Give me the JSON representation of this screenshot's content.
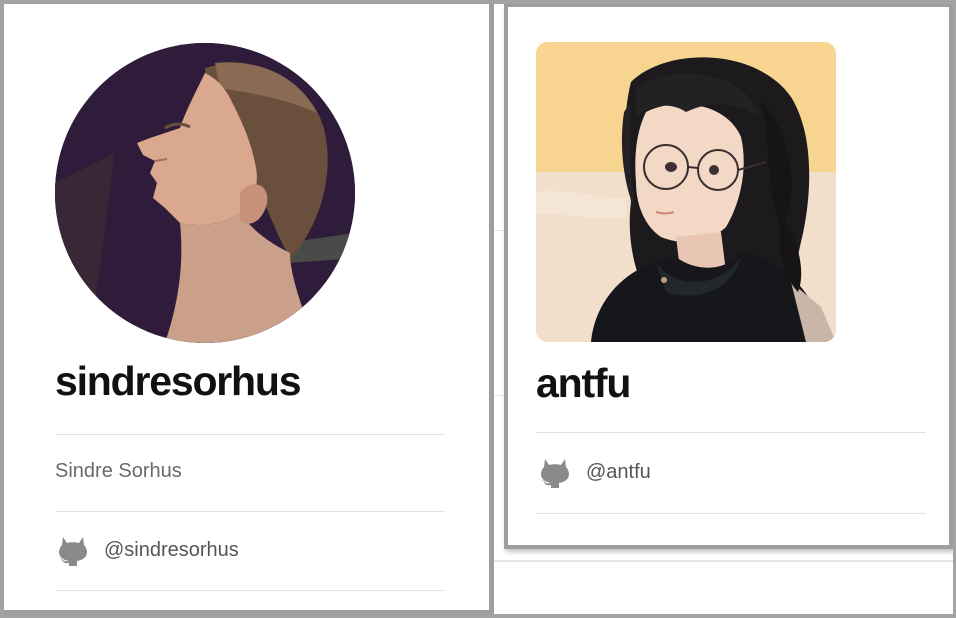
{
  "cards": [
    {
      "username": "sindresorhus",
      "full_name": "Sindre Sorhus",
      "github_handle": "@sindresorhus",
      "avatar_shape": "circle"
    },
    {
      "username": "antfu",
      "github_handle": "@antfu",
      "avatar_shape": "rounded-square"
    }
  ],
  "icons": {
    "github": "github-icon"
  },
  "colors": {
    "frame_border": "#a3a3a3",
    "divider": "#e2e2e2",
    "name_text": "#111111",
    "secondary_text": "#6a6a6a",
    "icon_gray": "#8a8a8a"
  }
}
